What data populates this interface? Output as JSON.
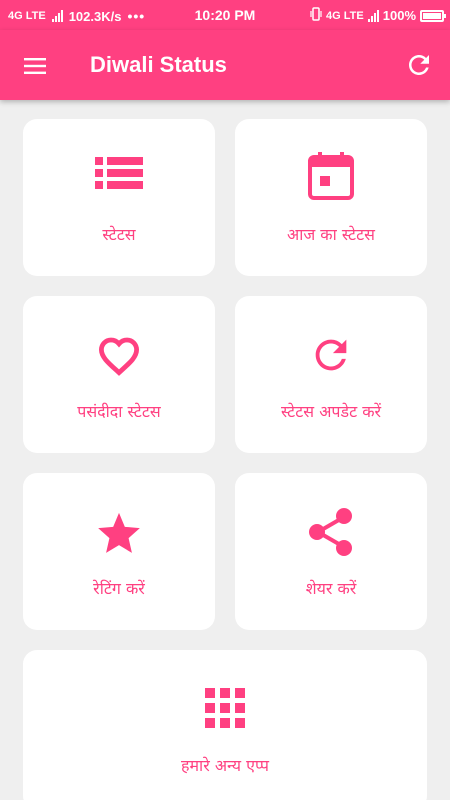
{
  "status_bar": {
    "network_left": "4G LTE",
    "speed": "102.3K/s",
    "dots": "•••",
    "time": "10:20 PM",
    "network_right": "4G LTE",
    "battery": "100%"
  },
  "app_bar": {
    "title": "Diwali Status",
    "menu_icon": "menu-icon",
    "refresh_icon": "refresh-icon"
  },
  "colors": {
    "primary": "#ff4081",
    "background": "#efefef",
    "card": "#ffffff"
  },
  "menu": {
    "items": [
      {
        "label": "स्टेटस",
        "icon": "list-icon"
      },
      {
        "label": "आज का स्टेटस",
        "icon": "calendar-icon"
      },
      {
        "label": "पसंदीदा स्टेटस",
        "icon": "heart-icon"
      },
      {
        "label": "स्टेटस अपडेट करें",
        "icon": "refresh-icon"
      },
      {
        "label": "रेटिंग करें",
        "icon": "star-icon"
      },
      {
        "label": "शेयर करें",
        "icon": "share-icon"
      },
      {
        "label": "हमारे अन्य एप्प",
        "icon": "apps-grid-icon"
      }
    ]
  }
}
